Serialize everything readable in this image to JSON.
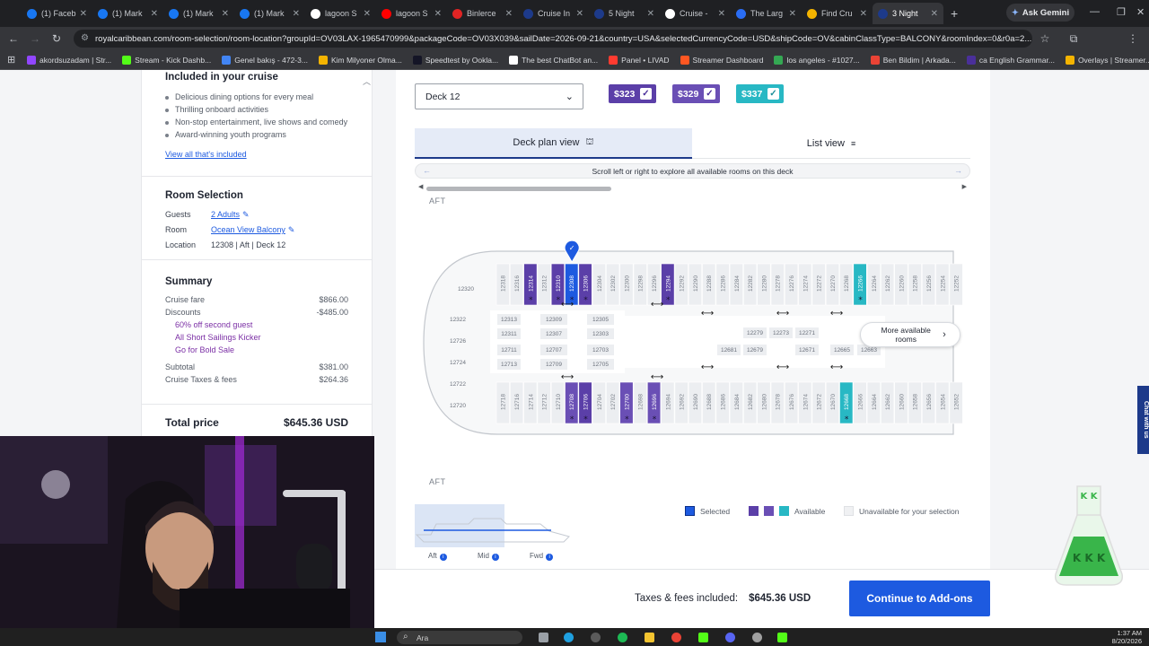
{
  "browser": {
    "tabs": [
      {
        "label": "(1) Faceb",
        "color": "#1877f2"
      },
      {
        "label": "(1) Mark",
        "color": "#1877f2"
      },
      {
        "label": "(1) Mark",
        "color": "#1877f2"
      },
      {
        "label": "(1) Mark",
        "color": "#1877f2"
      },
      {
        "label": "lagoon S",
        "color": "#ffffff"
      },
      {
        "label": "lagoon S",
        "color": "#ff0000"
      },
      {
        "label": "Binlerce",
        "color": "#e02424"
      },
      {
        "label": "Cruise In",
        "color": "#1d3a8a"
      },
      {
        "label": "5 Night",
        "color": "#1d3a8a"
      },
      {
        "label": "Cruise -",
        "color": "#ffffff"
      },
      {
        "label": "The Larg",
        "color": "#2a6df4"
      },
      {
        "label": "Find Cru",
        "color": "#f4b400"
      },
      {
        "label": "3 Night",
        "color": "#1d3a8a"
      }
    ],
    "ask_gemini": "Ask Gemini",
    "url": "royalcaribbean.com/room-selection/room-location?groupId=OV03LAX-1965470999&packageCode=OV03X039&sailDate=2026-09-21&country=USA&selectedCurrencyCode=USD&shipCode=OV&cabinClassType=BALCONY&roomIndex=0&r0a=2...",
    "bookmarks": [
      {
        "label": "akordsuzadam | Str...",
        "color": "#9146ff"
      },
      {
        "label": "Stream - Kick Dashb...",
        "color": "#53fc18"
      },
      {
        "label": "Genel bakış - 472-3...",
        "color": "#4285f4"
      },
      {
        "label": "Kim Milyoner Olma...",
        "color": "#f4b400"
      },
      {
        "label": "Speedtest by Ookla...",
        "color": "#141526"
      },
      {
        "label": "The best ChatBot an...",
        "color": "#ffffff"
      },
      {
        "label": "Panel • LIVAD",
        "color": "#ff3b30"
      },
      {
        "label": "Streamer Dashboard",
        "color": "#ff5722"
      },
      {
        "label": "los angeles - #1027...",
        "color": "#34a853"
      },
      {
        "label": "Ben Bildim | Arkada...",
        "color": "#ea4335"
      },
      {
        "label": "ca English Grammar...",
        "color": "#4a2f9a"
      },
      {
        "label": "Overlays | Streamer...",
        "color": "#f4b400"
      }
    ]
  },
  "sidebar": {
    "included_title": "Included in your cruise",
    "included_items": [
      "Delicious dining options for every meal",
      "Thrilling onboard activities",
      "Non-stop entertainment, live shows and comedy",
      "Award-winning youth programs"
    ],
    "view_all": "View all that's included",
    "room_selection": {
      "title": "Room Selection",
      "guests_label": "Guests",
      "guests_value": "2 Adults",
      "room_label": "Room",
      "room_value": "Ocean View Balcony",
      "location_label": "Location",
      "location_value": "12308  |  Aft  |  Deck 12"
    },
    "summary": {
      "title": "Summary",
      "cruise_fare_label": "Cruise fare",
      "cruise_fare": "$866.00",
      "discounts_label": "Discounts",
      "discounts": "-$485.00",
      "promos": [
        "60% off second guest",
        "All Short Sailings Kicker",
        "Go for Bold Sale"
      ],
      "subtotal_label": "Subtotal",
      "subtotal": "$381.00",
      "taxes_label": "Cruise Taxes & fees",
      "taxes": "$264.36",
      "total_label": "Total price",
      "total": "$645.36 USD"
    }
  },
  "main": {
    "deck": "Deck 12",
    "prices": [
      {
        "label": "$323",
        "color": "#5b3fa8"
      },
      {
        "label": "$329",
        "color": "#6a4fb5"
      },
      {
        "label": "$337",
        "color": "#28b8c4"
      }
    ],
    "deck_plan_tab": "Deck plan view",
    "list_view_tab": "List view",
    "scroll_hint": "Scroll left or right to explore all available rooms on this deck",
    "aft_top": "AFT",
    "aft_bottom": "AFT",
    "more_rooms": "More available rooms",
    "legend": {
      "selected": "Selected",
      "available": "Available",
      "unavailable": "Unavailable for your selection"
    },
    "minimap": {
      "aft": "Aft",
      "mid": "Mid",
      "fwd": "Fwd"
    },
    "selected_room": "12308",
    "top_rooms": [
      "12318",
      "12316",
      "12314",
      "12312",
      "12310",
      "12308",
      "12306",
      "12304",
      "12302",
      "12300",
      "12298",
      "12296",
      "12294",
      "12292",
      "12290",
      "12288",
      "12286",
      "12284",
      "12282",
      "12280",
      "12278",
      "12276",
      "12274",
      "12272",
      "12270",
      "12268",
      "12266",
      "12264",
      "12262",
      "12260",
      "12258",
      "12256",
      "12254",
      "12252"
    ],
    "bottom_rooms": [
      "12718",
      "12716",
      "12714",
      "12712",
      "12710",
      "12708",
      "12706",
      "12704",
      "12702",
      "12700",
      "12698",
      "12696",
      "12694",
      "12692",
      "12690",
      "12688",
      "12686",
      "12684",
      "12682",
      "12680",
      "12678",
      "12676",
      "12674",
      "12672",
      "12670",
      "12668",
      "12666",
      "12664",
      "12662",
      "12660",
      "12658",
      "12656",
      "12654",
      "12652"
    ],
    "inner_left": [
      "12313",
      "12311",
      "12711",
      "12713"
    ],
    "inner_mid": [
      "12309",
      "12307",
      "12707",
      "12709"
    ],
    "inner_right": [
      "12305",
      "12303",
      "12703",
      "12705"
    ],
    "inner_far": [
      "12279",
      "12273",
      "12271",
      "12681",
      "12679",
      "12671",
      "12665",
      "12663"
    ],
    "aft_rooms": [
      "12320",
      "12322",
      "12726",
      "12724",
      "12722",
      "12720"
    ],
    "purple_top": [
      "12314",
      "12310",
      "12306",
      "12294"
    ],
    "cyan_top": [
      "12266"
    ],
    "purple_bottom": [
      "12708",
      "12706",
      "12700",
      "12696"
    ],
    "cyan_bottom": [
      "12668"
    ]
  },
  "footer": {
    "taxes_label": "Taxes & fees included:",
    "taxes_value": "$645.36 USD",
    "continue": "Continue to Add-ons"
  },
  "chat_tab": "Chat with us",
  "taskbar": {
    "search": "Ara",
    "time": "1:37 AM",
    "date": "8/20/2026"
  }
}
